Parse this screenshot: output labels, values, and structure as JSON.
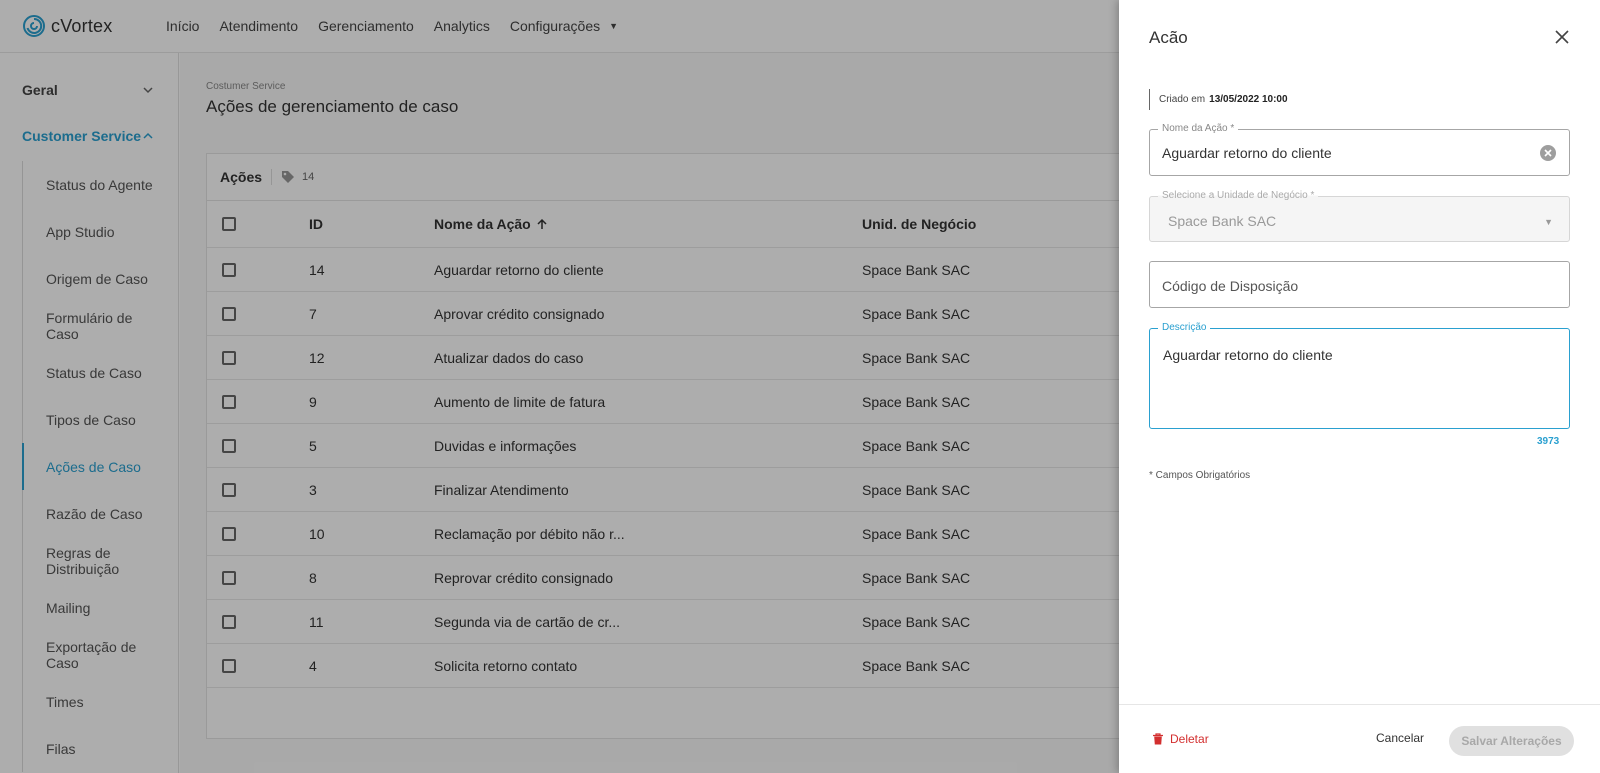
{
  "app": {
    "name": "cVortex"
  },
  "nav": {
    "items": [
      "Início",
      "Atendimento",
      "Gerenciamento",
      "Analytics"
    ],
    "config_label": "Configurações"
  },
  "sidebar": {
    "group_general": "Geral",
    "group_cs": "Customer Service",
    "items": [
      "Status do Agente",
      "App Studio",
      "Origem de Caso",
      "Formulário de Caso",
      "Status de Caso",
      "Tipos de Caso",
      "Ações de Caso",
      "Razão de Caso",
      "Regras de Distribuição",
      "Mailing",
      "Exportação de Caso",
      "Times",
      "Filas"
    ],
    "active_index": 6
  },
  "page": {
    "breadcrumb": "Costumer Service",
    "title": "Ações de gerenciamento de caso"
  },
  "table": {
    "title": "Ações",
    "count": "14",
    "columns": {
      "id": "ID",
      "name": "Nome da Ação",
      "unit": "Unid. de Negócio"
    },
    "rows": [
      {
        "id": "14",
        "name": "Aguardar retorno do cliente",
        "unit": "Space Bank SAC"
      },
      {
        "id": "7",
        "name": "Aprovar crédito consignado",
        "unit": "Space Bank SAC"
      },
      {
        "id": "12",
        "name": "Atualizar dados do caso",
        "unit": "Space Bank SAC"
      },
      {
        "id": "9",
        "name": "Aumento de limite de fatura",
        "unit": "Space Bank SAC"
      },
      {
        "id": "5",
        "name": "Duvidas e informações",
        "unit": "Space Bank SAC"
      },
      {
        "id": "3",
        "name": "Finalizar Atendimento",
        "unit": "Space Bank SAC"
      },
      {
        "id": "10",
        "name": "Reclamação por débito não r...",
        "unit": "Space Bank SAC"
      },
      {
        "id": "8",
        "name": "Reprovar crédito consignado",
        "unit": "Space Bank SAC"
      },
      {
        "id": "11",
        "name": "Segunda via de cartão de cr...",
        "unit": "Space Bank SAC"
      },
      {
        "id": "4",
        "name": "Solicita retorno contato",
        "unit": "Space Bank SAC"
      }
    ]
  },
  "drawer": {
    "title": "Acão",
    "created_label": "Criado em",
    "created_value": "13/05/2022 10:00",
    "action_name_label": "Nome da Ação *",
    "action_name_value": "Aguardar retorno do cliente",
    "unit_label": "Selecione a Unidade de Negócio *",
    "unit_value": "Space Bank SAC",
    "disposition_placeholder": "Código de Disposição",
    "description_label": "Descrição",
    "description_value": "Aguardar retorno do cliente",
    "char_counter": "3973",
    "required_note": "* Campos Obrigatórios",
    "delete_label": "Deletar",
    "cancel_label": "Cancelar",
    "save_label": "Salvar Alterações"
  },
  "colors": {
    "accent": "#2aa0d0",
    "danger": "#d32f2f"
  }
}
